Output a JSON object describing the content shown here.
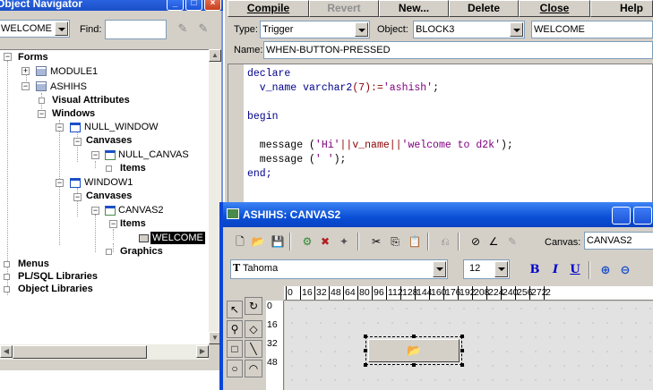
{
  "navigator": {
    "title": "Object Navigator",
    "module_combo": "WELCOME",
    "find_label": "Find:",
    "find_value": "",
    "tree": {
      "forms": "Forms",
      "module1": "MODULE1",
      "ashihs": "ASHIHS",
      "visual_attributes": "Visual Attributes",
      "windows": "Windows",
      "null_window": "NULL_WINDOW",
      "canvases_1": "Canvases",
      "null_canvas": "NULL_CANVAS",
      "items_1": "Items",
      "window1": "WINDOW1",
      "canvases_2": "Canvases",
      "canvas2": "CANVAS2",
      "items_2": "Items",
      "welcome": "WELCOME",
      "graphics": "Graphics",
      "menus": "Menus",
      "plsql_libraries": "PL/SQL Libraries",
      "object_libraries": "Object Libraries"
    }
  },
  "editor": {
    "buttons": {
      "compile": "Compile",
      "revert": "Revert",
      "new": "New...",
      "delete": "Delete",
      "close": "Close",
      "help": "Help"
    },
    "type_label": "Type:",
    "type_value": "Trigger",
    "object_label": "Object:",
    "object_value": "BLOCK3",
    "item_value": "WELCOME",
    "name_label": "Name:",
    "name_value": "WHEN-BUTTON-PRESSED",
    "code": {
      "l1": "declare",
      "l2_a": "  v_name ",
      "l2_b": "varchar2",
      "l2_c": "(7):=",
      "l2_d": "'ashish'",
      "l2_e": ";",
      "l3": "begin",
      "l4_a": "  message (",
      "l4_b": "'Hi'",
      "l4_c": "||v_name||",
      "l4_d": "'welcome to d2k'",
      "l4_e": ");",
      "l5_a": "  message (",
      "l5_b": "' '",
      "l5_c": ");",
      "l6": "end;"
    }
  },
  "canvas_window": {
    "title": "ASHIHS: CANVAS2",
    "canvas_label": "Canvas:",
    "canvas_value": "CANVAS2",
    "font_name": "Tahoma",
    "font_size": "12",
    "bold": "B",
    "italic": "I",
    "underline": "U",
    "ruler_h": [
      "0",
      "16",
      "32",
      "48",
      "64",
      "80",
      "96",
      "112",
      "128",
      "144",
      "160",
      "176",
      "192",
      "208",
      "224",
      "240",
      "256",
      "272",
      "2"
    ],
    "ruler_v": [
      "0",
      "16",
      "32",
      "48"
    ]
  },
  "colors": {
    "xp_title_blue": "#0a4fd6",
    "keyword": "#00008b",
    "string": "#800080",
    "face": "#d4d0c8"
  }
}
